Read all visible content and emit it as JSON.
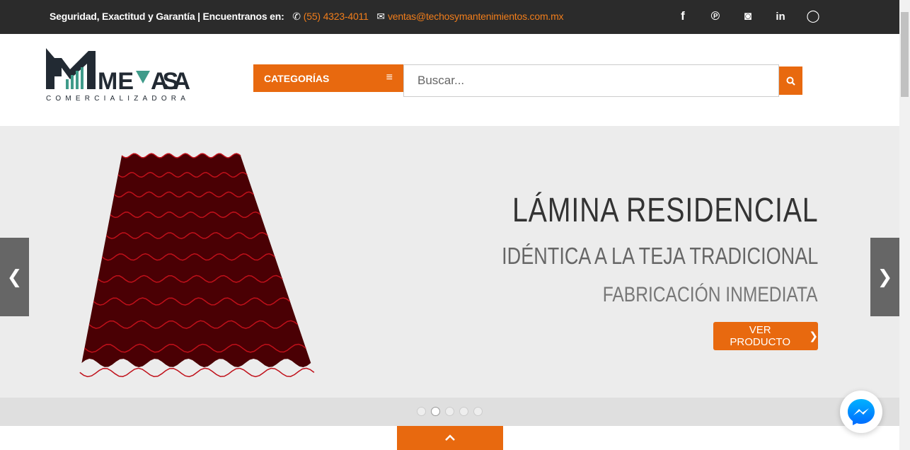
{
  "topbar": {
    "tagline": "Seguridad, Exactitud y Garantía | Encuentranos en:",
    "phone": "(55) 4323-4011",
    "email": "ventas@techosymantenimientos.com.mx",
    "social": [
      "facebook-icon",
      "pinterest-icon",
      "instagram-icon",
      "linkedin-icon",
      "whatsapp-icon"
    ]
  },
  "logo": {
    "name": "MEVASA",
    "sub": "COMERCIALIZADORA"
  },
  "header": {
    "categories": "CATEGORÍAS",
    "search_placeholder": "Buscar..."
  },
  "slide": {
    "title": "LÁMINA RESIDENCIAL",
    "subtitle": "IDÉNTICA A LA TEJA TRADICIONAL",
    "line3": "FABRICACIÓN INMEDIATA",
    "button": "VER PRODUCTO",
    "dots": 5,
    "active_dot": 1
  },
  "colors": {
    "accent": "#e8690f",
    "topbar": "#2b2b2b",
    "roof": "#4a0004"
  }
}
